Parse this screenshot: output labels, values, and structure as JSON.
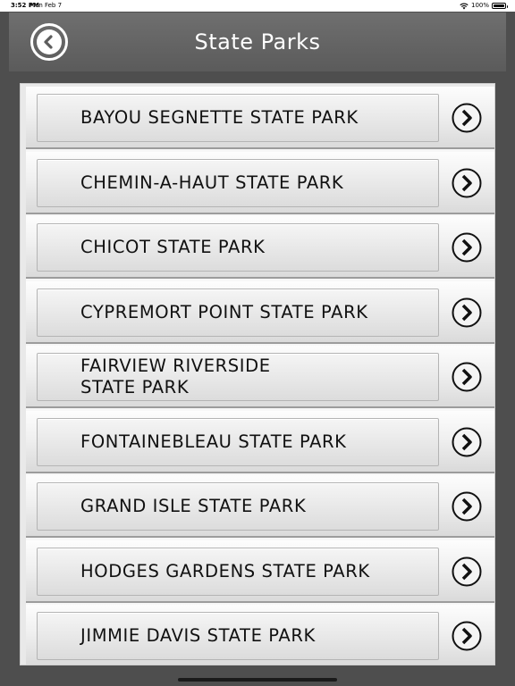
{
  "status_bar": {
    "time": "3:52 PM",
    "date": "Mon Feb 7",
    "battery": "100%"
  },
  "header": {
    "title": "State Parks",
    "back_icon": "chevron-left-circle-icon"
  },
  "parks": [
    {
      "name": "BAYOU SEGNETTE STATE PARK"
    },
    {
      "name": "CHEMIN-A-HAUT STATE PARK"
    },
    {
      "name": "CHICOT STATE PARK"
    },
    {
      "name": "CYPREMORT POINT STATE PARK"
    },
    {
      "name": "FAIRVIEW RIVERSIDE\nSTATE PARK"
    },
    {
      "name": "FONTAINEBLEAU STATE PARK"
    },
    {
      "name": "GRAND ISLE STATE PARK"
    },
    {
      "name": "HODGES GARDENS STATE PARK"
    },
    {
      "name": "JIMMIE DAVIS STATE PARK"
    }
  ],
  "row_icon": "chevron-right-circle-icon",
  "colors": {
    "background": "#4e4e4e",
    "navbar": "#666666",
    "title_text": "#ffffff",
    "row_text": "#111111"
  }
}
